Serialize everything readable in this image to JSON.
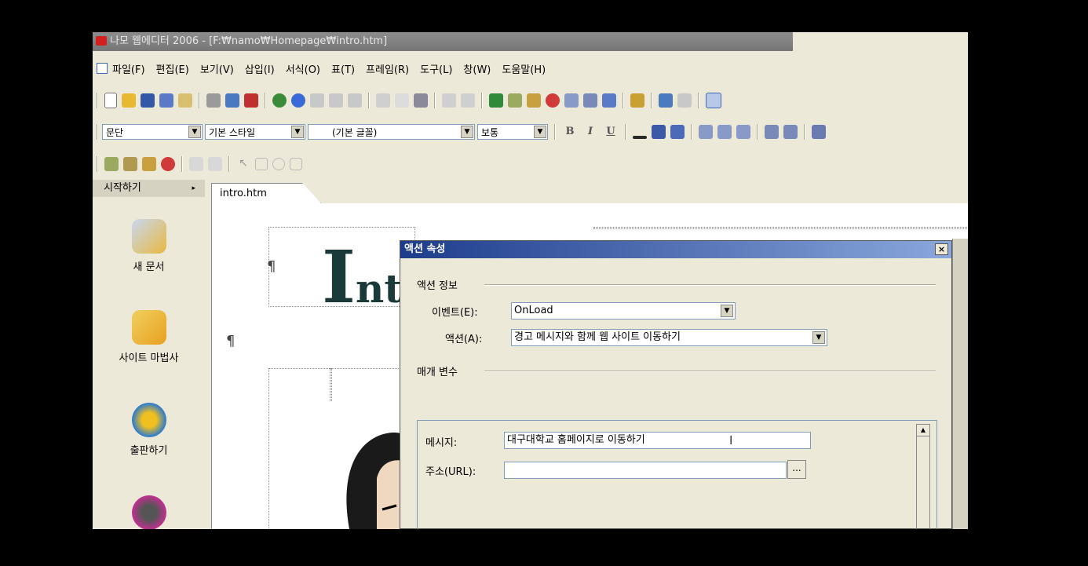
{
  "window": {
    "title": "나모 웹에디터 2006 - [F:₩namo₩Homepage₩intro.htm]"
  },
  "menubar": {
    "items": [
      "파일(F)",
      "편집(E)",
      "보기(V)",
      "삽입(I)",
      "서식(O)",
      "표(T)",
      "프레임(R)",
      "도구(L)",
      "창(W)",
      "도움말(H)"
    ]
  },
  "format_toolbar": {
    "paragraph_style": "문단",
    "class_style": "기본 스타일",
    "font": "(기본 글꼴)",
    "font_size": "보통",
    "bold": "B",
    "italic": "I",
    "underline": "U"
  },
  "left_panel": {
    "header": "시작하기",
    "header_arrow": "▸",
    "items": [
      {
        "label": "새 문서",
        "icon": "new-document-icon"
      },
      {
        "label": "사이트 마법사",
        "icon": "site-wizard-icon"
      },
      {
        "label": "출판하기",
        "icon": "publish-icon"
      },
      {
        "label": "",
        "icon": "multimedia-icon"
      }
    ]
  },
  "editor": {
    "tab": "intro.htm",
    "pilcrow": "¶",
    "heading_first": "I",
    "heading_rest": "nt"
  },
  "dialog": {
    "title": "액션 속성",
    "close": "×",
    "action_info_group": "액션 정보",
    "event_label": "이벤트(E):",
    "event_value": "OnLoad",
    "action_label": "액션(A):",
    "action_value": "경고 메시지와 함께 웹 사이트 이동하기",
    "params_group": "매개 변수",
    "message_label": "메시지:",
    "message_value": "대구대학교 홈페이지로 이동하기",
    "url_label": "주소(URL):",
    "url_value": "",
    "browse_button": "..."
  },
  "colors": {
    "accent": "#1d3c8c",
    "window_bg": "#ece9d8",
    "heading": "#1a3a3a"
  }
}
